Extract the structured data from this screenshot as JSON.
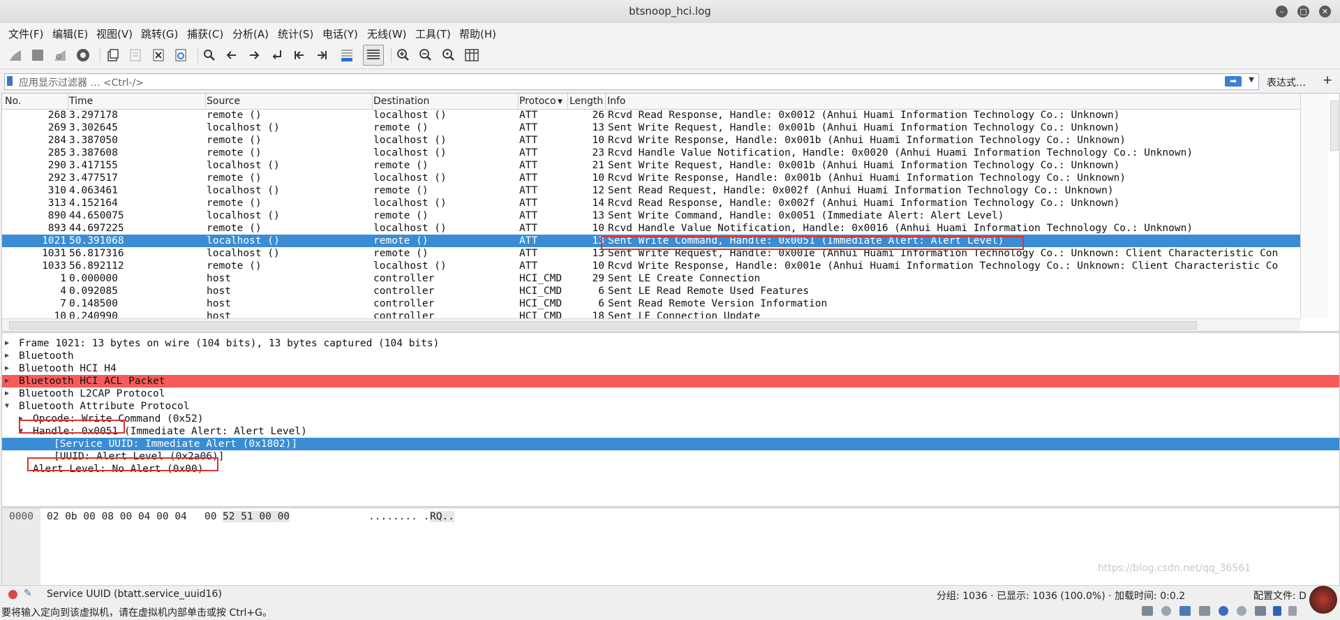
{
  "window": {
    "title": "btsnoop_hci.log"
  },
  "menu": [
    "文件(F)",
    "编辑(E)",
    "视图(V)",
    "跳转(G)",
    "捕获(C)",
    "分析(A)",
    "统计(S)",
    "电话(Y)",
    "无线(W)",
    "工具(T)",
    "帮助(H)"
  ],
  "toolbar_icons": [
    "shark-fin-start-icon",
    "stop-square-icon",
    "restart-fin-icon",
    "gear-options-icon",
    "open-folder-icon",
    "save-file-icon",
    "close-file-icon",
    "reload-icon",
    "search-icon",
    "back-arrow-icon",
    "forward-arrow-icon",
    "goto-packet-icon",
    "first-packet-icon",
    "last-packet-icon",
    "autoscroll-icon",
    "colorize-icon",
    "zoom-in-icon",
    "zoom-out-icon",
    "zoom-normal-icon",
    "resize-columns-icon"
  ],
  "filter": {
    "placeholder": "应用显示过滤器 … <Ctrl-/>",
    "expression_label": "表达式…",
    "plus_label": "+"
  },
  "packet_list": {
    "columns": [
      "No.",
      "Time",
      "Source",
      "Destination",
      "Protoco",
      "Length",
      "Info"
    ],
    "rows": [
      {
        "no": "268",
        "time": "3.297178",
        "src": "remote ()",
        "dst": "localhost ()",
        "proto": "ATT",
        "len": "26",
        "info": "Rcvd Read Response, Handle: 0x0012 (Anhui Huami Information Technology Co.: Unknown)"
      },
      {
        "no": "269",
        "time": "3.302645",
        "src": "localhost ()",
        "dst": "remote ()",
        "proto": "ATT",
        "len": "13",
        "info": "Sent Write Request, Handle: 0x001b (Anhui Huami Information Technology Co.: Unknown)"
      },
      {
        "no": "284",
        "time": "3.387050",
        "src": "remote ()",
        "dst": "localhost ()",
        "proto": "ATT",
        "len": "10",
        "info": "Rcvd Write Response, Handle: 0x001b (Anhui Huami Information Technology Co.: Unknown)"
      },
      {
        "no": "285",
        "time": "3.387608",
        "src": "remote ()",
        "dst": "localhost ()",
        "proto": "ATT",
        "len": "23",
        "info": "Rcvd Handle Value Notification, Handle: 0x0020 (Anhui Huami Information Technology Co.: Unknown)"
      },
      {
        "no": "290",
        "time": "3.417155",
        "src": "localhost ()",
        "dst": "remote ()",
        "proto": "ATT",
        "len": "21",
        "info": "Sent Write Request, Handle: 0x001b (Anhui Huami Information Technology Co.: Unknown)"
      },
      {
        "no": "292",
        "time": "3.477517",
        "src": "remote ()",
        "dst": "localhost ()",
        "proto": "ATT",
        "len": "10",
        "info": "Rcvd Write Response, Handle: 0x001b (Anhui Huami Information Technology Co.: Unknown)"
      },
      {
        "no": "310",
        "time": "4.063461",
        "src": "localhost ()",
        "dst": "remote ()",
        "proto": "ATT",
        "len": "12",
        "info": "Sent Read Request, Handle: 0x002f (Anhui Huami Information Technology Co.: Unknown)"
      },
      {
        "no": "313",
        "time": "4.152164",
        "src": "remote ()",
        "dst": "localhost ()",
        "proto": "ATT",
        "len": "14",
        "info": "Rcvd Read Response, Handle: 0x002f (Anhui Huami Information Technology Co.: Unknown)"
      },
      {
        "no": "890",
        "time": "44.650075",
        "src": "localhost ()",
        "dst": "remote ()",
        "proto": "ATT",
        "len": "13",
        "info": "Sent Write Command, Handle: 0x0051 (Immediate Alert: Alert Level)"
      },
      {
        "no": "893",
        "time": "44.697225",
        "src": "remote ()",
        "dst": "localhost ()",
        "proto": "ATT",
        "len": "10",
        "info": "Rcvd Handle Value Notification, Handle: 0x0016 (Anhui Huami Information Technology Co.: Unknown)"
      },
      {
        "no": "1021",
        "time": "50.391068",
        "src": "localhost ()",
        "dst": "remote ()",
        "proto": "ATT",
        "len": "13",
        "info": "Sent Write Command, Handle: 0x0051 (Immediate Alert: Alert Level)"
      },
      {
        "no": "1031",
        "time": "56.817316",
        "src": "localhost ()",
        "dst": "remote ()",
        "proto": "ATT",
        "len": "13",
        "info": "Sent Write Request, Handle: 0x001e (Anhui Huami Information Technology Co.: Unknown: Client Characteristic Con"
      },
      {
        "no": "1033",
        "time": "56.892112",
        "src": "remote ()",
        "dst": "localhost ()",
        "proto": "ATT",
        "len": "10",
        "info": "Rcvd Write Response, Handle: 0x001e (Anhui Huami Information Technology Co.: Unknown: Client Characteristic Co"
      },
      {
        "no": "1",
        "time": "0.000000",
        "src": "host",
        "dst": "controller",
        "proto": "HCI_CMD",
        "len": "29",
        "info": "Sent LE Create Connection"
      },
      {
        "no": "4",
        "time": "0.092085",
        "src": "host",
        "dst": "controller",
        "proto": "HCI_CMD",
        "len": "6",
        "info": "Sent LE Read Remote Used Features"
      },
      {
        "no": "7",
        "time": "0.148500",
        "src": "host",
        "dst": "controller",
        "proto": "HCI_CMD",
        "len": "6",
        "info": "Sent Read Remote Version Information"
      },
      {
        "no": "10",
        "time": "0.240990",
        "src": "host",
        "dst": "controller",
        "proto": "HCI_CMD",
        "len": "18",
        "info": "Sent LE Connection Update"
      }
    ],
    "selected_no": "1021"
  },
  "details": [
    {
      "text": "Frame 1021: 13 bytes on wire (104 bits), 13 bytes captured (104 bits)",
      "indent": 0,
      "state": "collapsed"
    },
    {
      "text": "Bluetooth",
      "indent": 0,
      "state": "collapsed"
    },
    {
      "text": "Bluetooth HCI H4",
      "indent": 0,
      "state": "collapsed"
    },
    {
      "text": "Bluetooth HCI ACL Packet",
      "indent": 0,
      "state": "collapsed",
      "highlight": "red"
    },
    {
      "text": "Bluetooth L2CAP Protocol",
      "indent": 0,
      "state": "collapsed"
    },
    {
      "text": "Bluetooth Attribute Protocol",
      "indent": 0,
      "state": "expanded"
    },
    {
      "text": "Opcode: Write Command (0x52)",
      "indent": 1,
      "state": "collapsed"
    },
    {
      "text": "Handle: 0x0051 (Immediate Alert: Alert Level)",
      "indent": 1,
      "state": "expanded"
    },
    {
      "text": "[Service UUID: Immediate Alert (0x1802)]",
      "indent": 2,
      "state": "none",
      "highlight": "selected"
    },
    {
      "text": "[UUID: Alert Level (0x2a06)]",
      "indent": 2,
      "state": "none"
    },
    {
      "text": "Alert Level: No Alert (0x00)",
      "indent": 1,
      "state": "none"
    }
  ],
  "hex": {
    "offset": "0000",
    "bytes_a": "02 0b 00 08 00 04 00 04",
    "bytes_b_plain": "00",
    "bytes_b_hl": "52 51 00 00",
    "ascii_plain": "........ .",
    "ascii_hl": "RQ.."
  },
  "status": {
    "field": "Service UUID (btatt.service_uuid16)",
    "stats": "分组: 1036 · 已显示: 1036 (100.0%) · 加载时间: 0:0.2",
    "profile": "配置文件: D"
  },
  "vm_hint": "要将输入定向到该虚拟机，请在虚拟机内部单击或按 Ctrl+G。",
  "watermark": "https://blog.csdn.net/qq_36561",
  "colors": {
    "selection": "#3a8dd4",
    "error_row": "#f65b5b",
    "annotation_box": "#e03030"
  }
}
